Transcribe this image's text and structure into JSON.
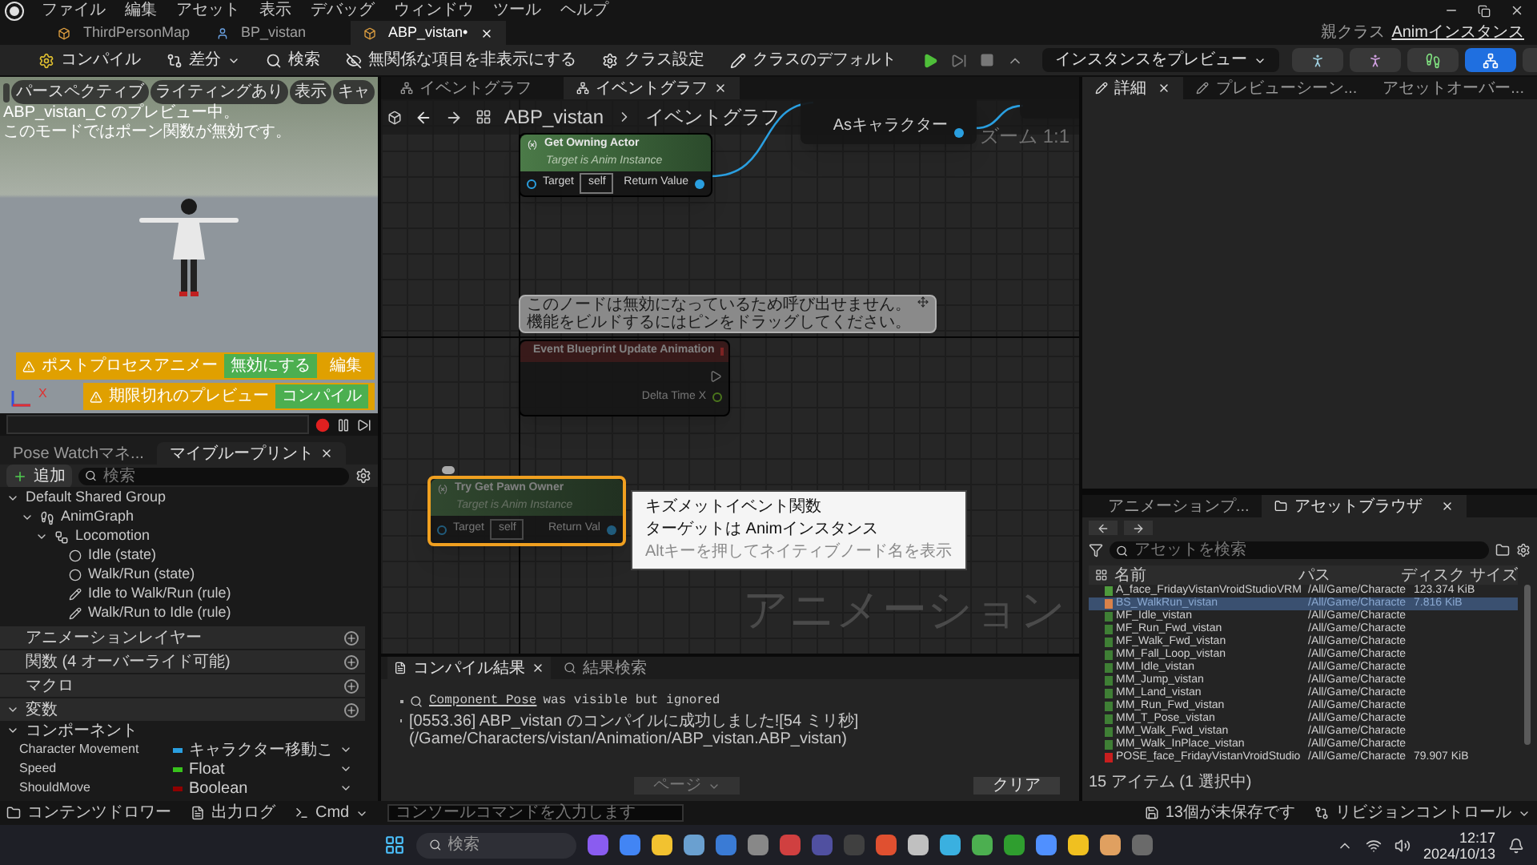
{
  "menu": {
    "items": [
      "ファイル",
      "編集",
      "アセット",
      "表示",
      "デバッグ",
      "ウィンドウ",
      "ツール",
      "ヘルプ"
    ]
  },
  "doc_tabs": [
    {
      "label": "ThirdPersonMap",
      "selected": false
    },
    {
      "label": "BP_vistan",
      "selected": false
    },
    {
      "label": "ABP_vistan•",
      "selected": true
    }
  ],
  "parent_class": {
    "label": "親クラス",
    "value": "Animインスタンス"
  },
  "toolbar": {
    "compile": "コンパイル",
    "diff": "差分",
    "search": "検索",
    "hide_unrelated": "無関係な項目を非表示にする",
    "class_settings": "クラス設定",
    "class_defaults": "クラスのデフォルト",
    "preview_instance": "インスタンスをプレビュー"
  },
  "viewport": {
    "buttons": [
      "パースペクティブ",
      "ライティングあり",
      "表示",
      "キャ"
    ],
    "notice": [
      "ABP_vistan_C のプレビュー中。",
      "このモードではポーン関数が無効です。"
    ],
    "warnings": [
      {
        "label": "ポストプロセスアニメー",
        "actions": [
          "無効にする",
          "編集"
        ]
      },
      {
        "label": "期限切れのプレビュー",
        "actions": [
          "コンパイル"
        ]
      }
    ],
    "axis_label": "X"
  },
  "my_blueprint": {
    "tabs": [
      {
        "label": "Pose Watchマネ...",
        "selected": false
      },
      {
        "label": "マイブループリント",
        "selected": true
      }
    ],
    "add": "追加",
    "search": {
      "placeholder": "検索"
    },
    "tree": [
      {
        "label": "Default Shared Group",
        "expanded": true,
        "children": [
          {
            "label": "AnimGraph",
            "kind": "graph",
            "expanded": true,
            "children": [
              {
                "label": "Locomotion",
                "kind": "machine",
                "expanded": true,
                "children": [
                  {
                    "label": "Idle (state)",
                    "kind": "state"
                  },
                  {
                    "label": "Walk/Run (state)",
                    "kind": "state"
                  },
                  {
                    "label": "Idle to Walk/Run (rule)",
                    "kind": "rule"
                  },
                  {
                    "label": "Walk/Run to Idle (rule)",
                    "kind": "rule"
                  }
                ]
              }
            ]
          }
        ]
      }
    ],
    "sections": [
      {
        "label": "アニメーションレイヤー",
        "expanded": false
      },
      {
        "label": "関数 (4 オーバーライド可能)",
        "expanded": false
      },
      {
        "label": "マクロ",
        "expanded": false
      },
      {
        "label": "変数",
        "expanded": true
      }
    ],
    "category": "コンポーネント",
    "variables": [
      {
        "name": "Character Movement",
        "type": "キャラクター移動こ",
        "color": "#2a9fe0"
      },
      {
        "name": "Speed",
        "type": "Float",
        "color": "#38c21c"
      },
      {
        "name": "ShouldMove",
        "type": "Boolean",
        "color": "#8f0000"
      }
    ]
  },
  "graph": {
    "tabs": [
      {
        "label": "イベントグラフ",
        "selected": false
      },
      {
        "label": "イベントグラフ",
        "selected": true
      }
    ],
    "breadcrumb": [
      "ABP_vistan",
      "イベントグラフ"
    ],
    "zoom": "ズーム 1:1",
    "watermark": "アニメーション",
    "nodes": [
      {
        "kind": "cast",
        "output": "Asキャラクター"
      },
      {
        "kind": "stub"
      },
      {
        "kind": "function",
        "title": "Get Owning Actor",
        "subtitle": "Target is Anim Instance",
        "input": "Target",
        "default": "self",
        "output": "Return Value",
        "selected": false,
        "disabled": false
      },
      {
        "kind": "event",
        "title": "Event Blueprint Update Animation",
        "output": "Delta Time X",
        "selected": false,
        "disabled": true
      },
      {
        "kind": "function",
        "title": "Try Get Pawn Owner",
        "subtitle": "Target is Anim Instance",
        "input": "Target",
        "default": "self",
        "output": "Return Val",
        "selected": true,
        "disabled": true
      }
    ],
    "comment": [
      "このノードは無効になっているため呼び出せません。",
      "機能をビルドするにはピンをドラッグしてください。"
    ],
    "tooltip": [
      "キズメットイベント関数",
      "ターゲットは Animインスタンス",
      "Altキーを押してネイティブノード名を表示"
    ]
  },
  "compiler": {
    "tabs": [
      {
        "label": "コンパイル結果",
        "selected": true
      },
      {
        "label": "結果検索",
        "selected": false
      }
    ],
    "link": "Component Pose",
    "lines": [
      "was visible but ignored",
      "[0553.36] ABP_vistan のコンパイルに成功しました![54 ミリ秒] (/Game/Characters/vistan/Animation/ABP_vistan.ABP_vistan)"
    ],
    "page": "ページ",
    "clear": "クリア"
  },
  "details": {
    "tabs": [
      {
        "label": "詳細",
        "selected": true
      },
      {
        "label": "プレビューシーン...",
        "selected": false
      },
      {
        "label": "アセットオーバー...",
        "selected": false
      }
    ]
  },
  "asset_browser": {
    "tabs": [
      {
        "label": "アニメーションプ...",
        "selected": false
      },
      {
        "label": "アセットブラウザ",
        "selected": true
      }
    ],
    "search": {
      "placeholder": "アセットを検索"
    },
    "columns": [
      "名前",
      "パス",
      "ディスク サイズ"
    ],
    "rows": [
      {
        "name": "A_face_FridayVistanVroidStudioVRM",
        "path": "/All/Game/Characte",
        "size": "123.374 KiB",
        "color": "#4e9a3c",
        "selected": false
      },
      {
        "name": "BS_WalkRun_vistan",
        "path": "/All/Game/Characte",
        "size": "7.816 KiB",
        "color": "#d9824a",
        "selected": true
      },
      {
        "name": "MF_Idle_vistan",
        "path": "/All/Game/Characte",
        "color": "#3f7f35",
        "selected": false
      },
      {
        "name": "MF_Run_Fwd_vistan",
        "path": "/All/Game/Characte",
        "color": "#3f7f35",
        "selected": false
      },
      {
        "name": "MF_Walk_Fwd_vistan",
        "path": "/All/Game/Characte",
        "color": "#3f7f35",
        "selected": false
      },
      {
        "name": "MM_Fall_Loop_vistan",
        "path": "/All/Game/Characte",
        "color": "#3f7f35",
        "selected": false
      },
      {
        "name": "MM_Idle_vistan",
        "path": "/All/Game/Characte",
        "color": "#3f7f35",
        "selected": false
      },
      {
        "name": "MM_Jump_vistan",
        "path": "/All/Game/Characte",
        "color": "#3f7f35",
        "selected": false
      },
      {
        "name": "MM_Land_vistan",
        "path": "/All/Game/Characte",
        "color": "#3f7f35",
        "selected": false
      },
      {
        "name": "MM_Run_Fwd_vistan",
        "path": "/All/Game/Characte",
        "color": "#3f7f35",
        "selected": false
      },
      {
        "name": "MM_T_Pose_vistan",
        "path": "/All/Game/Characte",
        "color": "#3f7f35",
        "selected": false
      },
      {
        "name": "MM_Walk_Fwd_vistan",
        "path": "/All/Game/Characte",
        "color": "#3f7f35",
        "selected": false
      },
      {
        "name": "MM_Walk_InPlace_vistan",
        "path": "/All/Game/Characte",
        "color": "#3f7f35",
        "selected": false
      },
      {
        "name": "POSE_face_FridayVistanVroidStudio",
        "path": "/All/Game/Characte",
        "size": "79.907 KiB",
        "color": "#c81e1e",
        "selected": false
      }
    ],
    "status": "15 アイテム (1 選択中)"
  },
  "status_bar": {
    "content_drawer": "コンテンツドロワー",
    "output_log": "出力ログ",
    "cmd": "Cmd",
    "console": {
      "placeholder": "コンソールコマンドを入力します"
    },
    "unsaved": "13個が未保存です",
    "revision": "リビジョンコントロール"
  },
  "taskbar": {
    "search": {
      "placeholder": "検索"
    },
    "time": "12:17",
    "date": "2024/10/13"
  }
}
